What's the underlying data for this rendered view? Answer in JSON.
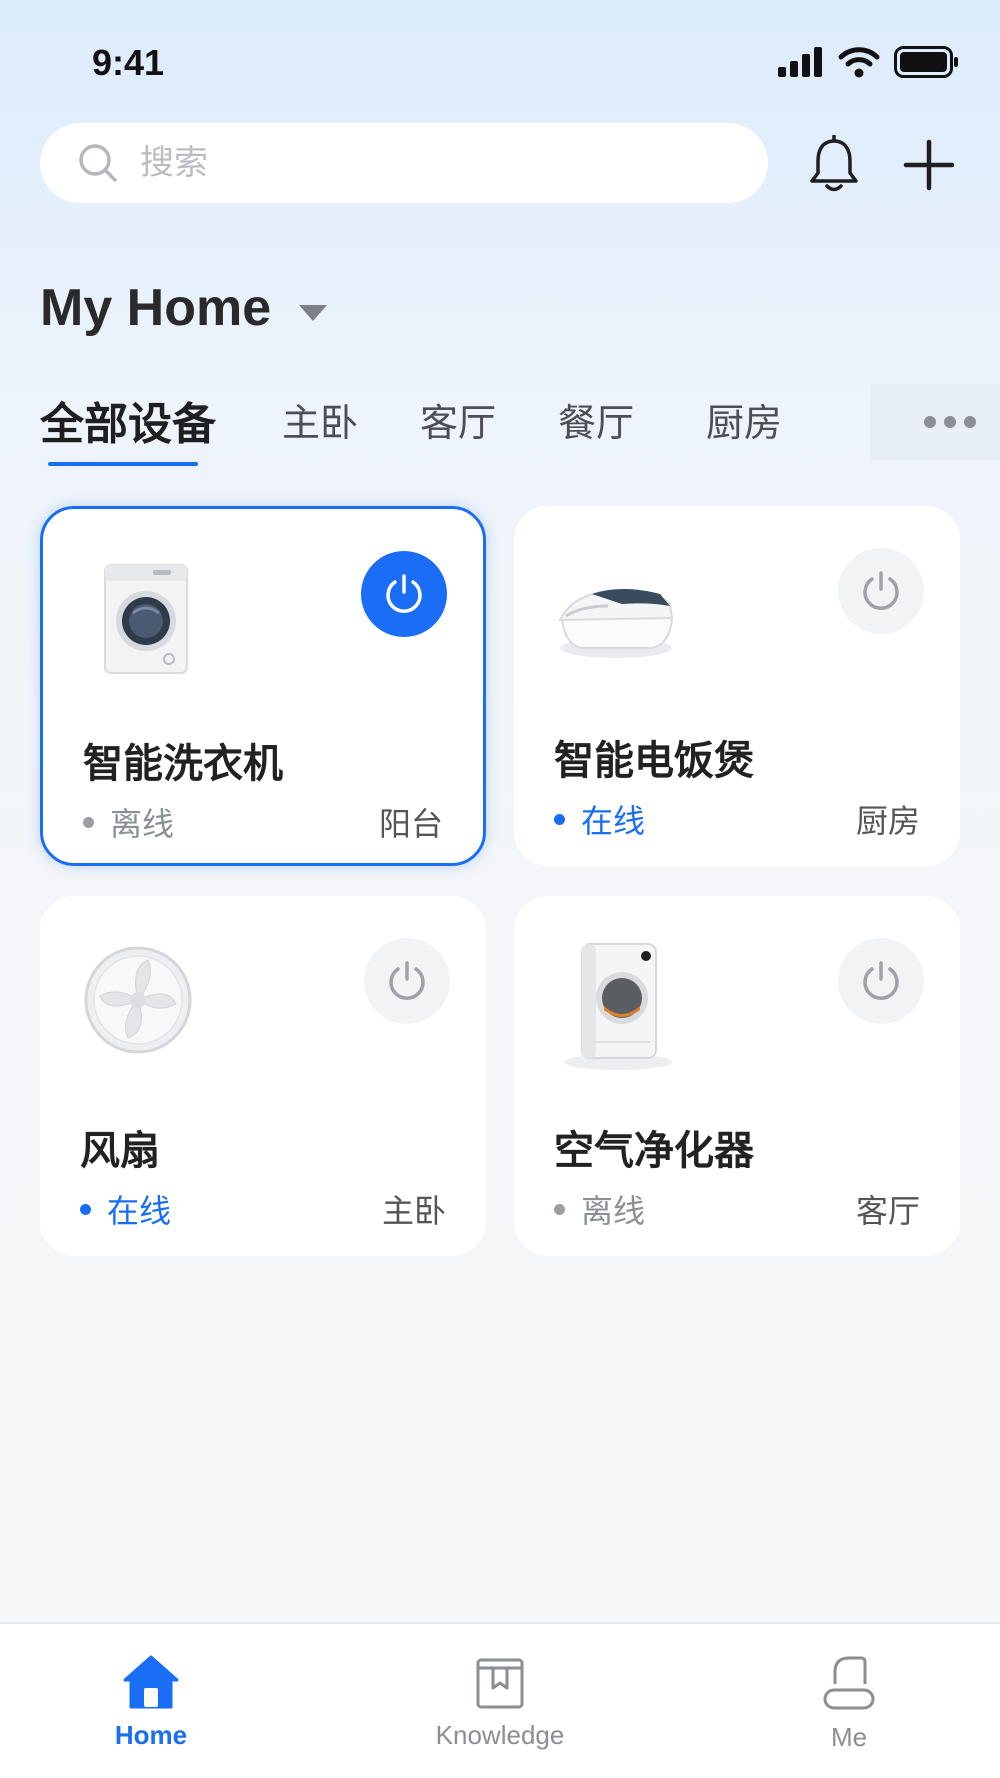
{
  "status_bar": {
    "time": "9:41"
  },
  "search": {
    "placeholder": "搜索"
  },
  "home": {
    "title": "My Home"
  },
  "tabs": [
    {
      "label": "全部设备",
      "active": true
    },
    {
      "label": "主卧"
    },
    {
      "label": "客厅"
    },
    {
      "label": "餐厅"
    },
    {
      "label": "厨房"
    }
  ],
  "devices": [
    {
      "name": "智能洗衣机",
      "status": "离线",
      "room": "阳台",
      "power": "on",
      "selected": true,
      "icon": "washing-machine-image"
    },
    {
      "name": "智能电饭煲",
      "status": "在线",
      "room": "厨房",
      "power": "off",
      "icon": "rice-cooker-image"
    },
    {
      "name": "风扇",
      "status": "在线",
      "room": "主卧",
      "power": "off",
      "icon": "fan-image"
    },
    {
      "name": "空气净化器",
      "status": "离线",
      "room": "客厅",
      "power": "off",
      "icon": "air-purifier-image"
    }
  ],
  "bottom_nav": [
    {
      "label": "Home",
      "icon": "home-icon",
      "active": true
    },
    {
      "label": "Knowledge",
      "icon": "book-icon"
    },
    {
      "label": "Me",
      "icon": "user-icon"
    }
  ],
  "colors": {
    "accent": "#1a6ef5",
    "offline": "#9a9da3",
    "card": "#ffffff"
  }
}
